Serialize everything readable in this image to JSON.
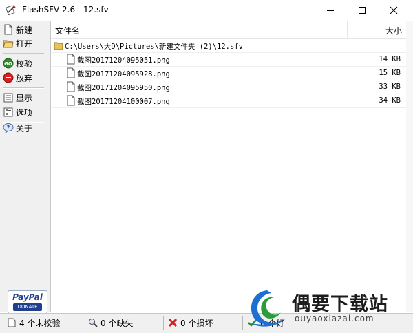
{
  "window": {
    "title": "FlashSFV 2.6 - 12.sfv"
  },
  "sidebar": {
    "items": [
      {
        "label": "新建",
        "icon": "new-document-icon"
      },
      {
        "label": "打开",
        "icon": "open-folder-icon"
      },
      {
        "label": "校验",
        "icon": "go-check-icon"
      },
      {
        "label": "放弃",
        "icon": "stop-icon"
      },
      {
        "label": "显示",
        "icon": "display-icon"
      },
      {
        "label": "选项",
        "icon": "options-icon"
      },
      {
        "label": "关于",
        "icon": "about-icon"
      }
    ],
    "donate": {
      "brand": "PayPal",
      "label": "DONATE"
    }
  },
  "list": {
    "columns": {
      "name": "文件名",
      "size": "大小"
    },
    "folder_path": "C:\\Users\\大D\\Pictures\\新建文件夹 (2)\\12.sfv",
    "files": [
      {
        "name": "截图20171204095051.png",
        "size": "14 KB"
      },
      {
        "name": "截图20171204095928.png",
        "size": "15 KB"
      },
      {
        "name": "截图20171204095950.png",
        "size": "33 KB"
      },
      {
        "name": "截图20171204100007.png",
        "size": "34 KB"
      }
    ]
  },
  "status": {
    "unchecked": "4 个未校验",
    "missing": "0 个缺失",
    "damaged": "0 个损坏",
    "good": "0 个好"
  },
  "watermark": {
    "name": "偶要下载站",
    "url": "ouyaoxiazai.com"
  },
  "colors": {
    "accent_blue": "#1f3f8f",
    "stop_red": "#d42020",
    "go_green": "#2e8b2e",
    "folder_yellow": "#e8c15a"
  }
}
